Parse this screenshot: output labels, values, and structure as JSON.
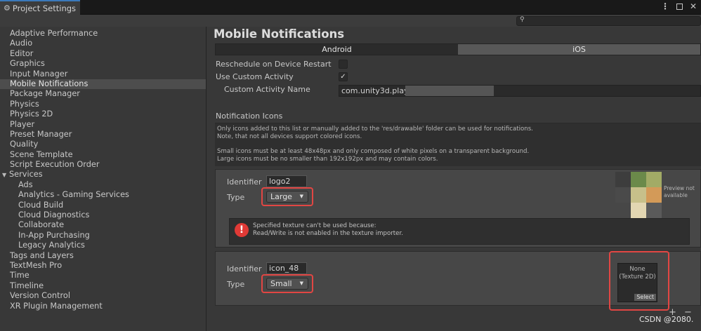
{
  "window": {
    "tab_title": "Project Settings"
  },
  "sidebar": {
    "items": [
      {
        "label": "Adaptive Performance"
      },
      {
        "label": "Audio"
      },
      {
        "label": "Editor"
      },
      {
        "label": "Graphics"
      },
      {
        "label": "Input Manager"
      },
      {
        "label": "Mobile Notifications",
        "selected": true
      },
      {
        "label": "Package Manager"
      },
      {
        "label": "Physics"
      },
      {
        "label": "Physics 2D"
      },
      {
        "label": "Player"
      },
      {
        "label": "Preset Manager"
      },
      {
        "label": "Quality"
      },
      {
        "label": "Scene Template"
      },
      {
        "label": "Script Execution Order"
      },
      {
        "label": "Services",
        "expandable": true
      },
      {
        "label": "Ads",
        "child": true
      },
      {
        "label": "Analytics - Gaming Services",
        "child": true
      },
      {
        "label": "Cloud Build",
        "child": true
      },
      {
        "label": "Cloud Diagnostics",
        "child": true
      },
      {
        "label": "Collaborate",
        "child": true
      },
      {
        "label": "In-App Purchasing",
        "child": true
      },
      {
        "label": "Legacy Analytics",
        "child": true
      },
      {
        "label": "Tags and Layers"
      },
      {
        "label": "TextMesh Pro"
      },
      {
        "label": "Time"
      },
      {
        "label": "Timeline"
      },
      {
        "label": "Version Control"
      },
      {
        "label": "XR Plugin Management"
      }
    ]
  },
  "main": {
    "title": "Mobile Notifications",
    "tabs": [
      {
        "label": "Android",
        "active": true
      },
      {
        "label": "iOS",
        "active": false
      }
    ],
    "reschedule_label": "Reschedule on Device Restart",
    "reschedule_checked": false,
    "use_custom_activity_label": "Use Custom Activity",
    "use_custom_activity_checked": true,
    "custom_activity_name_label": "Custom Activity Name",
    "custom_activity_name_value": "com.unity3d.playe",
    "notification_icons_label": "Notification Icons",
    "help_lines": [
      "Only icons added to this list or manually added to the 'res/drawable' folder can be used for notifications.",
      "Note, that not all devices support colored icons.",
      "",
      "Small icons must be at least 48x48px and only composed of white pixels on a transparent background.",
      "Large icons must be no smaller than 192x192px and may contain colors."
    ],
    "icons": [
      {
        "identifier_label": "Identifier",
        "identifier": "logo2",
        "type_label": "Type",
        "type": "Large",
        "preview_note_line1": "Preview not",
        "preview_note_line2": "available",
        "warning_line1": "Specified texture can't be used because:",
        "warning_line2": "Read/Write is not enabled in the texture importer."
      },
      {
        "identifier_label": "Identifier",
        "identifier": "icon_48",
        "type_label": "Type",
        "type": "Small",
        "texture_line1": "None",
        "texture_line2": "(Texture 2D)",
        "texture_select": "Select"
      }
    ],
    "add_symbol": "+",
    "remove_symbol": "−"
  },
  "watermark": "CSDN @2080.",
  "icons_meta": {
    "tab_icon": "gear-icon",
    "search_icon": "search-icon",
    "warning_icon": "error-icon"
  },
  "colors": {
    "accent": "#3a79bb",
    "highlight_box": "#e24643",
    "error": "#e03a36"
  }
}
